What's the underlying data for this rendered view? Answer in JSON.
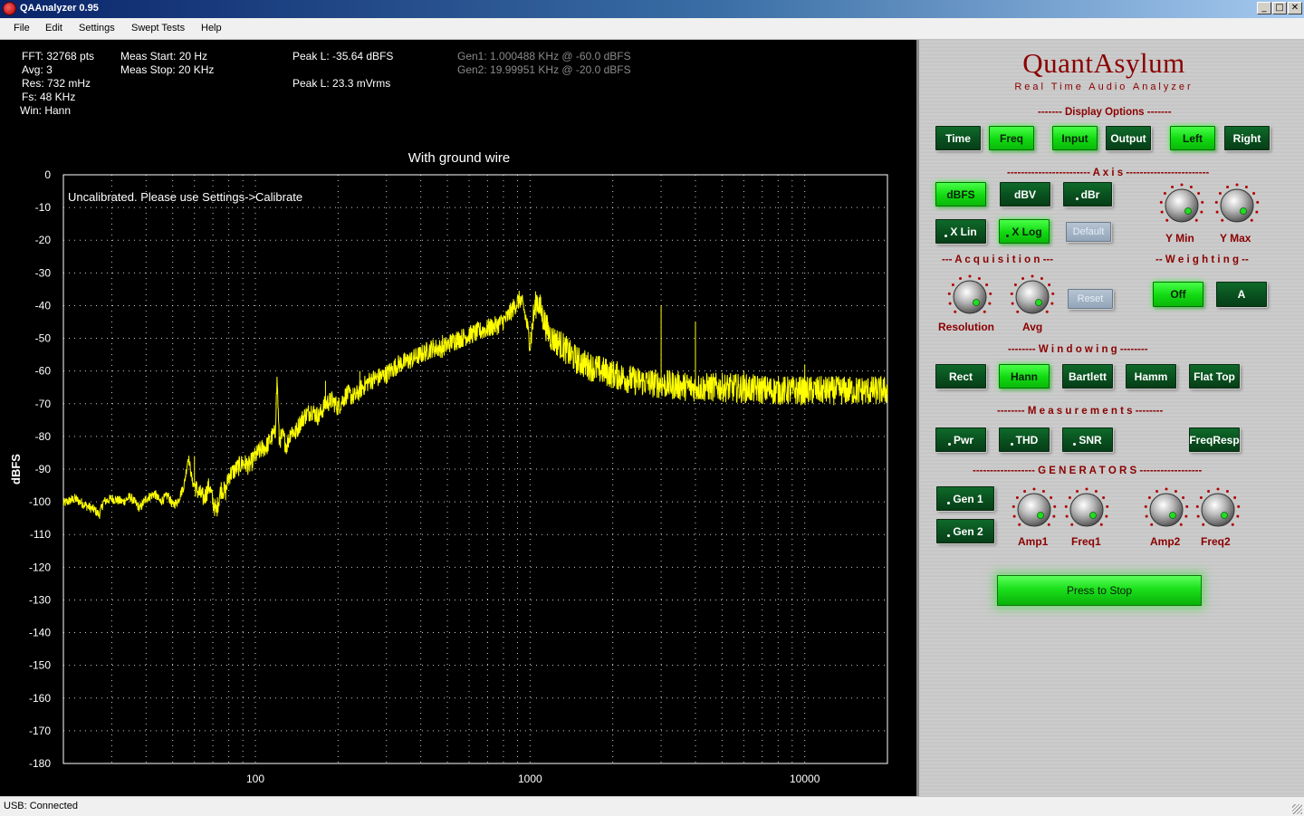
{
  "window": {
    "title": "QAAnalyzer 0.95",
    "controls": [
      "_",
      "□",
      "✕"
    ]
  },
  "menu": [
    "File",
    "Edit",
    "Settings",
    "Swept Tests",
    "Help"
  ],
  "info": {
    "fft": "FFT: 32768 pts",
    "avg": "Avg: 3",
    "res": "Res: 732 mHz",
    "fs": "Fs: 48 KHz",
    "win": "Win: Hann",
    "meas_start": "Meas Start: 20 Hz",
    "meas_stop": "Meas Stop: 20 KHz",
    "peak_dbfs": "Peak L: -35.64 dBFS",
    "peak_mv": "Peak L: 23.3 mVrms",
    "gen1": "Gen1: 1.000488 KHz @ -60.0 dBFS",
    "gen2": "Gen2: 19.99951 KHz @ -20.0 dBFS"
  },
  "plot": {
    "title": "With ground wire",
    "note": "Uncalibrated. Please use Settings->Calibrate",
    "ylabel": "dBFS",
    "y_ticks": [
      "0",
      "-10",
      "-20",
      "-30",
      "-40",
      "-50",
      "-60",
      "-70",
      "-80",
      "-90",
      "-100",
      "-110",
      "-120",
      "-130",
      "-140",
      "-150",
      "-160",
      "-170",
      "-180"
    ],
    "x_ticks": [
      "100",
      "1000",
      "10000"
    ],
    "x_range_hz": [
      20,
      20000
    ],
    "y_range_dbfs": [
      -180,
      0
    ],
    "x_scale": "log",
    "grid": true,
    "trace_color": "#ffff00",
    "trace_points": [
      [
        20,
        -100.5
      ],
      [
        22,
        -99
      ],
      [
        24,
        -101
      ],
      [
        26,
        -102.5
      ],
      [
        27,
        -104
      ],
      [
        28,
        -100
      ],
      [
        30,
        -99
      ],
      [
        33,
        -100
      ],
      [
        35,
        -98.5
      ],
      [
        38,
        -102
      ],
      [
        40,
        -99
      ],
      [
        43,
        -97.5
      ],
      [
        45,
        -100
      ],
      [
        48,
        -98
      ],
      [
        50,
        -101
      ],
      [
        52,
        -100
      ],
      [
        55,
        -95
      ],
      [
        57,
        -86
      ],
      [
        59,
        -94
      ],
      [
        62,
        -97
      ],
      [
        65,
        -99
      ],
      [
        68,
        -95
      ],
      [
        70,
        -100
      ],
      [
        72,
        -103
      ],
      [
        75,
        -96
      ],
      [
        78,
        -97
      ],
      [
        80,
        -92
      ],
      [
        85,
        -90
      ],
      [
        90,
        -88
      ],
      [
        95,
        -89
      ],
      [
        100,
        -86
      ],
      [
        105,
        -84
      ],
      [
        110,
        -83
      ],
      [
        115,
        -80
      ],
      [
        118,
        -79
      ],
      [
        120,
        -62
      ],
      [
        122,
        -81
      ],
      [
        126,
        -80
      ],
      [
        130,
        -83
      ],
      [
        135,
        -78
      ],
      [
        140,
        -79
      ],
      [
        145,
        -76
      ],
      [
        150,
        -74
      ],
      [
        160,
        -72
      ],
      [
        170,
        -74
      ],
      [
        180,
        -70
      ],
      [
        190,
        -69
      ],
      [
        200,
        -71
      ],
      [
        215,
        -67
      ],
      [
        230,
        -68
      ],
      [
        245,
        -65
      ],
      [
        260,
        -63
      ],
      [
        280,
        -62
      ],
      [
        300,
        -61
      ],
      [
        330,
        -58
      ],
      [
        360,
        -57
      ],
      [
        400,
        -55
      ],
      [
        440,
        -53
      ],
      [
        480,
        -53
      ],
      [
        520,
        -51
      ],
      [
        560,
        -50
      ],
      [
        600,
        -49
      ],
      [
        650,
        -48
      ],
      [
        700,
        -47
      ],
      [
        760,
        -46
      ],
      [
        820,
        -44
      ],
      [
        880,
        -40
      ],
      [
        920,
        -38
      ],
      [
        950,
        -41
      ],
      [
        980,
        -47
      ],
      [
        1000,
        -52
      ],
      [
        1030,
        -43
      ],
      [
        1060,
        -38
      ],
      [
        1100,
        -42
      ],
      [
        1150,
        -47
      ],
      [
        1200,
        -50
      ],
      [
        1300,
        -52
      ],
      [
        1400,
        -55
      ],
      [
        1500,
        -57
      ],
      [
        1700,
        -59
      ],
      [
        2000,
        -61
      ],
      [
        2400,
        -63
      ],
      [
        3000,
        -64
      ],
      [
        4000,
        -65
      ],
      [
        5000,
        -65
      ],
      [
        6500,
        -65.5
      ],
      [
        8000,
        -66
      ],
      [
        10000,
        -66
      ],
      [
        13000,
        -66
      ],
      [
        16000,
        -66
      ],
      [
        20000,
        -66
      ]
    ],
    "trace_spikes": [
      [
        60,
        -86
      ],
      [
        120,
        -62
      ],
      [
        180,
        -63
      ],
      [
        240,
        -60
      ],
      [
        300,
        -60
      ],
      [
        360,
        -55
      ],
      [
        420,
        -52
      ],
      [
        480,
        -49
      ],
      [
        540,
        -48
      ],
      [
        600,
        -47
      ],
      [
        3000,
        -40
      ],
      [
        4000,
        -45
      ],
      [
        6000,
        -60
      ],
      [
        10000,
        -58
      ]
    ]
  },
  "panel": {
    "brand": "QuantAsylum",
    "subtitle": "Real Time Audio Analyzer",
    "display_options_title": "------- Display Options -------",
    "display_buttons": [
      "Time",
      "Freq",
      "Input",
      "Output",
      "Left",
      "Right"
    ],
    "axis_title": "------------------------ A x i s ------------------------",
    "axis_buttons": [
      "dBFS",
      "dBV",
      "dBr"
    ],
    "x_buttons": [
      "X Lin",
      "X Log"
    ],
    "default_label": "Default",
    "y_knobs": [
      "Y Min",
      "Y Max"
    ],
    "acquisition_title": "--- A c q u i s i t i o n ---",
    "weighting_title": "-- W e i g h t i n g --",
    "acq_knobs": [
      "Resolution",
      "Avg"
    ],
    "reset_label": "Reset",
    "weighting_buttons": [
      "Off",
      "A"
    ],
    "windowing_title": "--------  W i n d o w i n g  --------",
    "window_buttons": [
      "Rect",
      "Hann",
      "Bartlett",
      "Hamm",
      "Flat Top"
    ],
    "measurements_title": "--------  M e a s u r e m e n t s  --------",
    "meas_buttons": [
      "Pwr",
      "THD",
      "SNR",
      "FreqResp"
    ],
    "generators_title": "------------------  G E N E R A T O R S  ------------------",
    "gen_buttons": [
      "Gen 1",
      "Gen 2"
    ],
    "gen_knobs": [
      "Amp1",
      "Freq1",
      "Amp2",
      "Freq2"
    ],
    "stop_label": "Press to Stop"
  },
  "status": "USB: Connected",
  "colors": {
    "plot_bg": "#000000",
    "trace": "#ffff00",
    "grid": "#ffffff",
    "brand": "#8b0000",
    "button_on": "#1ee01e",
    "button_off": "#0a5a22"
  }
}
